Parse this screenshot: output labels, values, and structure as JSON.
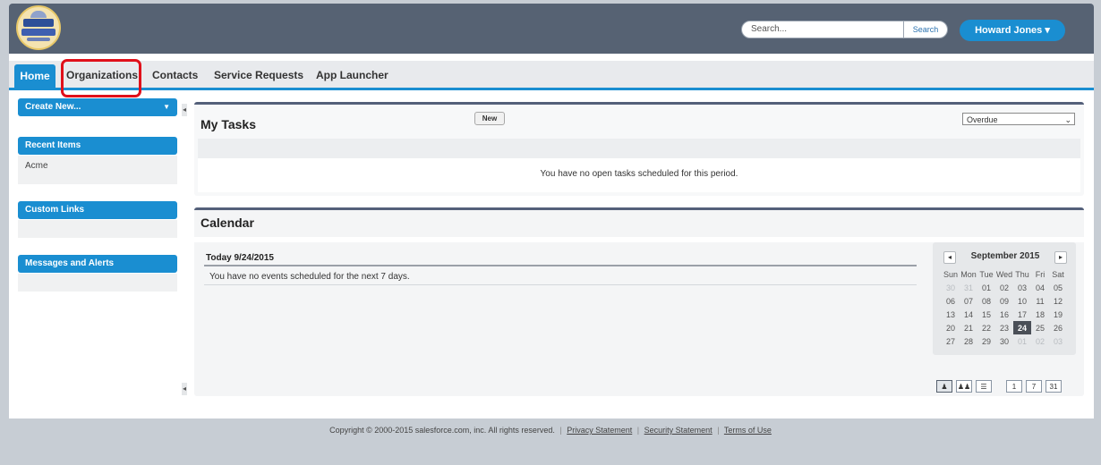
{
  "header": {
    "search_placeholder": "Search...",
    "search_button": "Search",
    "user_menu": "Howard Jones ▾"
  },
  "tabs": [
    "Home",
    "Organizations",
    "Contacts",
    "Service Requests",
    "App Launcher"
  ],
  "sidebar": {
    "create_new": "Create New...",
    "recent_items_title": "Recent Items",
    "recent_items": [
      "Acme"
    ],
    "custom_links_title": "Custom Links",
    "messages_title": "Messages and Alerts"
  },
  "tasks": {
    "title": "My Tasks",
    "new_button": "New",
    "filter_value": "Overdue",
    "empty_message": "You have no open tasks scheduled for this period."
  },
  "calendar": {
    "title": "Calendar",
    "today_label": "Today 9/24/2015",
    "events_empty": "You have no events scheduled for the next 7 days.",
    "mini": {
      "month": "September 2015",
      "weekdays": [
        "Sun",
        "Mon",
        "Tue",
        "Wed",
        "Thu",
        "Fri",
        "Sat"
      ],
      "weeks": [
        [
          "30",
          "31",
          "01",
          "02",
          "03",
          "04",
          "05"
        ],
        [
          "06",
          "07",
          "08",
          "09",
          "10",
          "11",
          "12"
        ],
        [
          "13",
          "14",
          "15",
          "16",
          "17",
          "18",
          "19"
        ],
        [
          "20",
          "21",
          "22",
          "23",
          "24",
          "25",
          "26"
        ],
        [
          "27",
          "28",
          "29",
          "30",
          "01",
          "02",
          "03"
        ]
      ],
      "today": "24"
    },
    "view_buttons": [
      "1",
      "7",
      "31"
    ]
  },
  "footer": {
    "copyright": "Copyright © 2000-2015 salesforce.com, inc. All rights reserved.",
    "links": [
      "Privacy Statement",
      "Security Statement",
      "Terms of Use"
    ]
  }
}
